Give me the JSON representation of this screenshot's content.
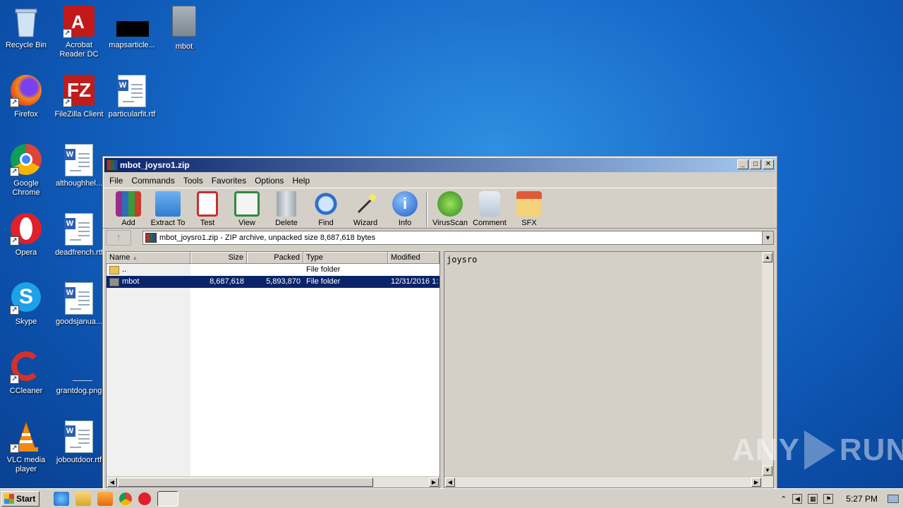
{
  "desktop": {
    "icons": [
      {
        "label": "Recycle Bin"
      },
      {
        "label": "Acrobat Reader DC"
      },
      {
        "label": "mapsarticle..."
      },
      {
        "label": "mbot"
      },
      {
        "label": "Firefox"
      },
      {
        "label": "FileZilla Client"
      },
      {
        "label": "particularfit.rtf"
      },
      {
        "label": "Google Chrome"
      },
      {
        "label": "althoughhel..."
      },
      {
        "label": "Opera"
      },
      {
        "label": "deadfrench.rtf"
      },
      {
        "label": "Skype"
      },
      {
        "label": "goodsjanua..."
      },
      {
        "label": "CCleaner"
      },
      {
        "label": "grantdog.png"
      },
      {
        "label": "VLC media player"
      },
      {
        "label": "joboutdoor.rtf"
      }
    ]
  },
  "window": {
    "title": "mbot_joysro1.zip",
    "menu": [
      "File",
      "Commands",
      "Tools",
      "Favorites",
      "Options",
      "Help"
    ],
    "toolbar": [
      {
        "label": "Add",
        "icon": "add-archive-icon"
      },
      {
        "label": "Extract To",
        "icon": "extract-folder-icon"
      },
      {
        "label": "Test",
        "icon": "test-clipboard-icon"
      },
      {
        "label": "View",
        "icon": "view-book-icon"
      },
      {
        "label": "Delete",
        "icon": "trash-icon"
      },
      {
        "label": "Find",
        "icon": "magnifier-icon"
      },
      {
        "label": "Wizard",
        "icon": "wand-icon"
      },
      {
        "label": "Info",
        "icon": "info-icon"
      },
      {
        "label": "VirusScan",
        "icon": "virus-scan-icon"
      },
      {
        "label": "Comment",
        "icon": "comment-icon"
      },
      {
        "label": "SFX",
        "icon": "sfx-box-icon"
      }
    ],
    "address": "mbot_joysro1.zip - ZIP archive, unpacked size 8,687,618 bytes",
    "columns": {
      "name": "Name",
      "size": "Size",
      "packed": "Packed",
      "type": "Type",
      "modified": "Modified"
    },
    "files": [
      {
        "name": "..",
        "size": "",
        "packed": "",
        "type": "File folder",
        "modified": ""
      },
      {
        "name": "mbot",
        "size": "8,687,618",
        "packed": "5,893,870",
        "type": "File folder",
        "modified": "12/31/2016 1:"
      }
    ],
    "comment": "joysro"
  },
  "watermark": {
    "left": "ANY",
    "right": "RUN"
  },
  "taskbar": {
    "start_label": "Start",
    "clock": "5:27 PM"
  }
}
